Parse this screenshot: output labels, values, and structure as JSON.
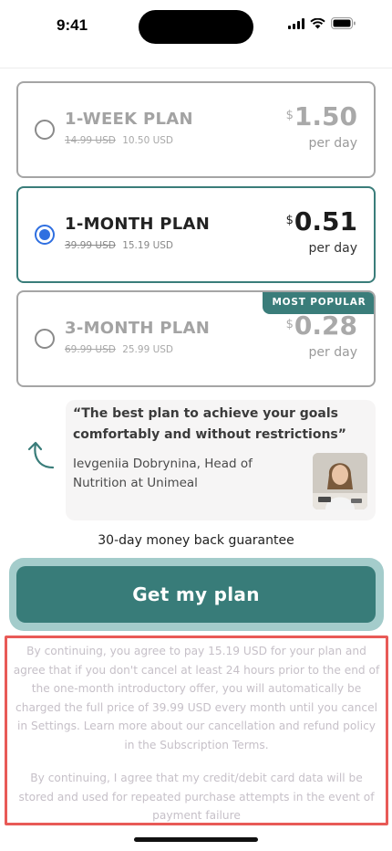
{
  "status_bar": {
    "time": "9:41"
  },
  "plans": [
    {
      "title": "1-WEEK PLAN",
      "old_price": "14.99 USD",
      "new_price": "10.50 USD",
      "currency": "$",
      "amount": "1.50",
      "unit": "per day",
      "selected": false,
      "badge": ""
    },
    {
      "title": "1-MONTH PLAN",
      "old_price": "39.99 USD",
      "new_price": "15.19 USD",
      "currency": "$",
      "amount": "0.51",
      "unit": "per day",
      "selected": true,
      "badge": ""
    },
    {
      "title": "3-MONTH PLAN",
      "old_price": "69.99 USD",
      "new_price": "25.99 USD",
      "currency": "$",
      "amount": "0.28",
      "unit": "per day",
      "selected": false,
      "badge": "MOST POPULAR"
    }
  ],
  "testimonial": {
    "quote": "“The best plan to achieve your goals comfortably and without restrictions”",
    "author": "Ievgeniia Dobrynina, Head of Nutrition at Unimeal"
  },
  "guarantee": "30-day money back guarantee",
  "cta": {
    "label": "Get my plan"
  },
  "terms": {
    "paragraph1": "By continuing, you agree to pay 15.19 USD for your plan and agree that if you don't cancel at least 24 hours prior to the end of the one-month introductory offer, you will automatically be charged the full price of 39.99 USD every month until you cancel in Settings. Learn more about our cancellation and refund policy in the Subscription Terms.",
    "paragraph2": "By continuing, I agree that my credit/debit card data will be stored and used for repeated purchase attempts in the event of payment failure"
  },
  "colors": {
    "accent": "#387c79",
    "radio_selected": "#2f6fe0",
    "highlight_border": "#e85a57"
  },
  "icons": [
    "signal-icon",
    "wifi-icon",
    "battery-icon",
    "curved-arrow-icon"
  ]
}
